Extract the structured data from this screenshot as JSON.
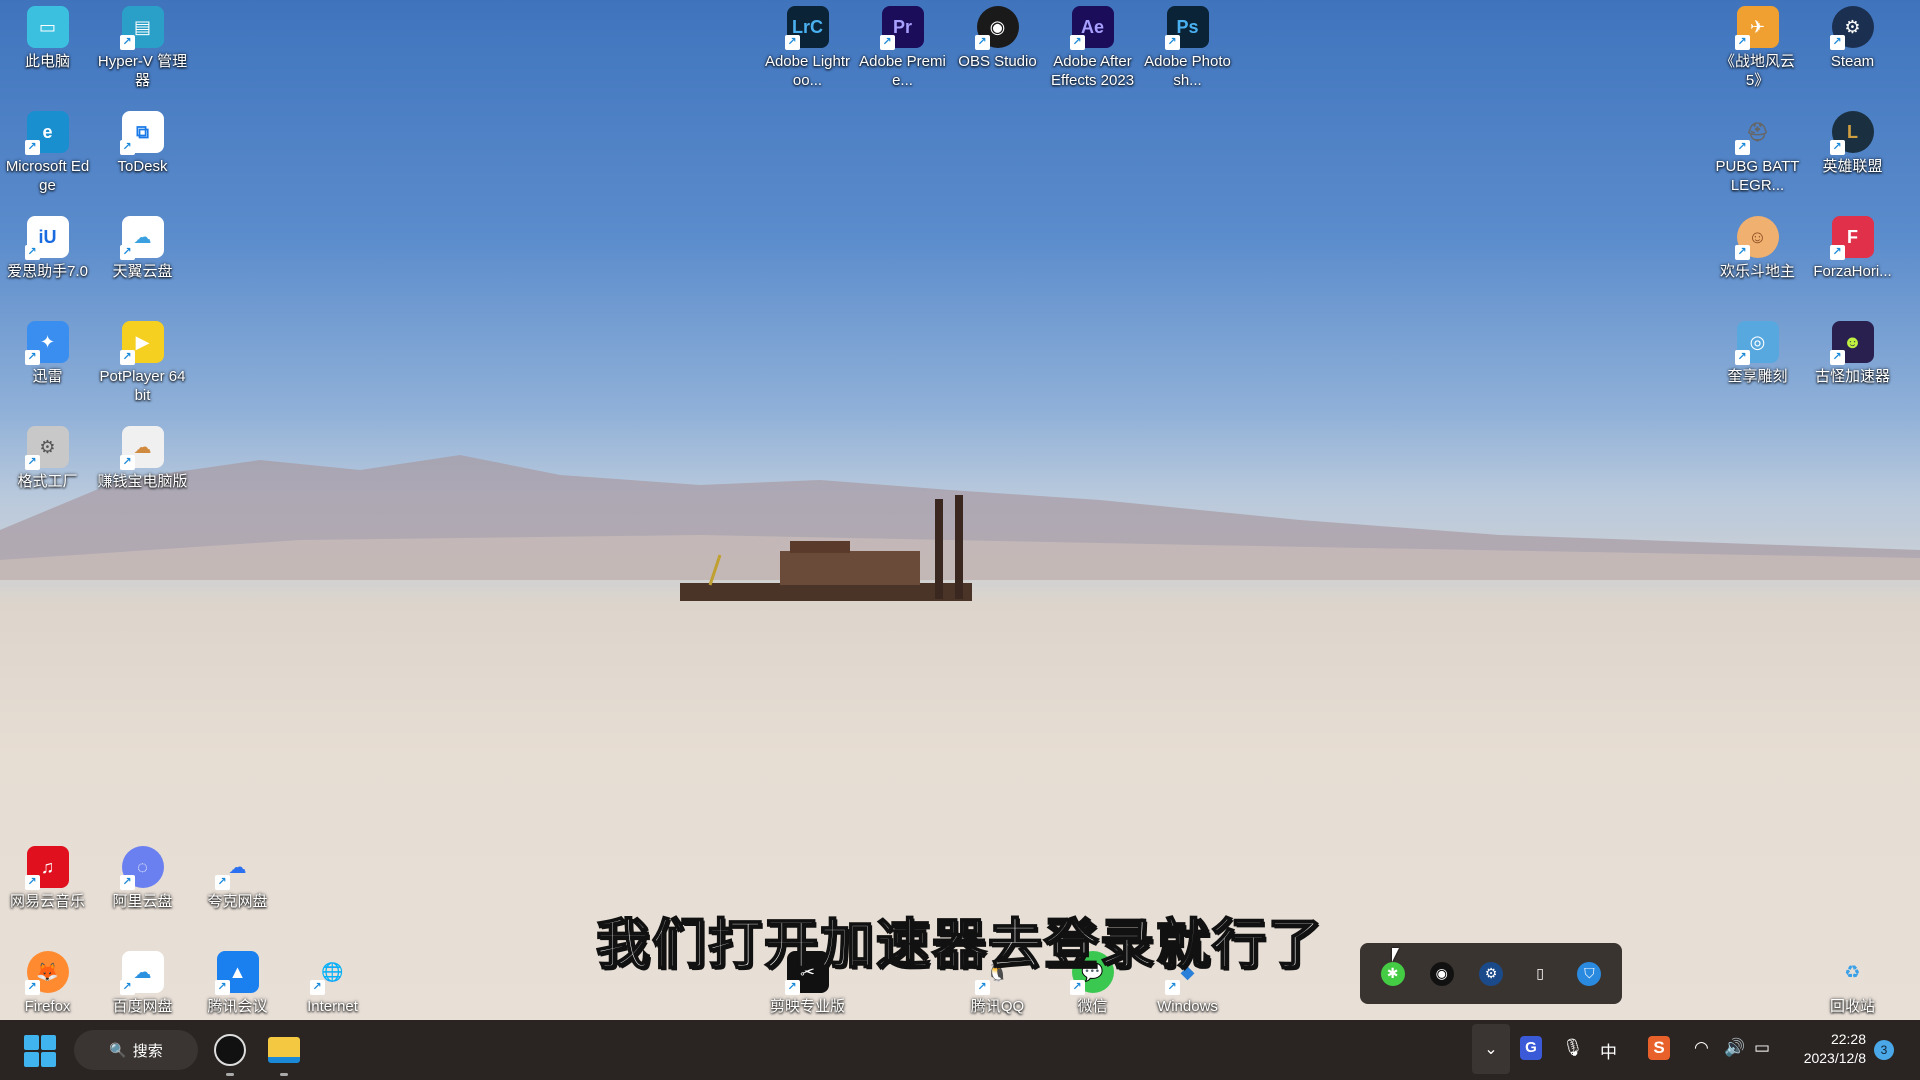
{
  "desktop": {
    "icons": [
      {
        "label": "此电脑",
        "glyph": "▭",
        "color": "#3cc0e0",
        "shortcut": false,
        "col": 0,
        "pos": "L",
        "row": 0
      },
      {
        "label": "Hyper-V 管理器",
        "glyph": "▤",
        "color": "#2aa0c8",
        "shortcut": true,
        "pos": "L",
        "col": 1,
        "row": 0
      },
      {
        "label": "Microsoft Edge",
        "glyph": "e",
        "color": "#1a8fd0",
        "shortcut": true,
        "pos": "L",
        "col": 0,
        "row": 1
      },
      {
        "label": "ToDesk",
        "glyph": "⧉",
        "color": "#ffffff",
        "fg": "#1a7ae8",
        "shortcut": true,
        "pos": "L",
        "col": 1,
        "row": 1
      },
      {
        "label": "爱思助手7.0",
        "glyph": "iU",
        "color": "#ffffff",
        "fg": "#1a6ae0",
        "shortcut": true,
        "pos": "L",
        "col": 0,
        "row": 2
      },
      {
        "label": "天翼云盘",
        "glyph": "☁",
        "color": "#ffffff",
        "fg": "#3aa0e0",
        "shortcut": true,
        "pos": "L",
        "col": 1,
        "row": 2
      },
      {
        "label": "迅雷",
        "glyph": "✦",
        "color": "#3a8ef0",
        "shortcut": true,
        "pos": "L",
        "col": 0,
        "row": 3
      },
      {
        "label": "PotPlayer 64 bit",
        "glyph": "▶",
        "color": "#f5d020",
        "shortcut": true,
        "pos": "L",
        "col": 1,
        "row": 3
      },
      {
        "label": "格式工厂",
        "glyph": "⚙",
        "color": "#c8c8c8",
        "fg": "#555",
        "shortcut": true,
        "pos": "L",
        "col": 0,
        "row": 4
      },
      {
        "label": "赚钱宝电脑版",
        "glyph": "☁",
        "color": "#f0f0f0",
        "fg": "#d08a40",
        "shortcut": true,
        "pos": "L",
        "col": 1,
        "row": 4
      },
      {
        "label": "Adobe Lightroo...",
        "glyph": "LrC",
        "color": "#0a2336",
        "fg": "#4ab0f0",
        "shortcut": true,
        "pos": "T",
        "col": 0
      },
      {
        "label": "Adobe Premie...",
        "glyph": "Pr",
        "color": "#1c0d5a",
        "fg": "#a8a0ff",
        "shortcut": true,
        "pos": "T",
        "col": 1
      },
      {
        "label": "OBS Studio",
        "glyph": "◉",
        "color": "#1a1a1a",
        "shortcut": true,
        "pos": "T",
        "col": 2,
        "round": true
      },
      {
        "label": "Adobe After Effects 2023",
        "glyph": "Ae",
        "color": "#1c0d5a",
        "fg": "#a8a0ff",
        "shortcut": true,
        "pos": "T",
        "col": 3
      },
      {
        "label": "Adobe Photosh...",
        "glyph": "Ps",
        "color": "#0a2336",
        "fg": "#4ab0f0",
        "shortcut": true,
        "pos": "T",
        "col": 4
      },
      {
        "label": "《战地风云 5》",
        "glyph": "✈",
        "color": "#f0a030",
        "shortcut": true,
        "pos": "R",
        "col": 0,
        "row": 0
      },
      {
        "label": "Steam",
        "glyph": "⚙",
        "color": "#1b2f50",
        "shortcut": true,
        "pos": "R",
        "col": 1,
        "row": 0,
        "round": true
      },
      {
        "label": "PUBG BATTLEGR...",
        "glyph": "⛑",
        "color": "transparent",
        "fg": "#666",
        "shortcut": true,
        "pos": "R",
        "col": 0,
        "row": 1
      },
      {
        "label": "英雄联盟",
        "glyph": "L",
        "color": "#1a3040",
        "fg": "#d0a040",
        "shortcut": true,
        "pos": "R",
        "col": 1,
        "row": 1,
        "round": true
      },
      {
        "label": "欢乐斗地主",
        "glyph": "☺",
        "color": "#f0b070",
        "fg": "#8a4a20",
        "shortcut": true,
        "pos": "R",
        "col": 0,
        "row": 2,
        "round": true
      },
      {
        "label": "ForzaHori...",
        "glyph": "F",
        "color": "#e0304a",
        "shortcut": true,
        "pos": "R",
        "col": 1,
        "row": 2
      },
      {
        "label": "奎享雕刻",
        "glyph": "◎",
        "color": "#58a8e0",
        "shortcut": true,
        "pos": "R",
        "col": 0,
        "row": 3
      },
      {
        "label": "古怪加速器",
        "glyph": "☻",
        "color": "#2a2050",
        "fg": "#c0f040",
        "shortcut": true,
        "pos": "R",
        "col": 1,
        "row": 3
      },
      {
        "label": "网易云音乐",
        "glyph": "♫",
        "color": "#e0101e",
        "shortcut": true,
        "pos": "B",
        "col": 0,
        "row": 0
      },
      {
        "label": "阿里云盘",
        "glyph": "◌",
        "color": "#6a80f0",
        "shortcut": true,
        "pos": "B",
        "col": 1,
        "row": 0,
        "round": true
      },
      {
        "label": "夸克网盘",
        "glyph": "☁",
        "color": "transparent",
        "fg": "#2a70f0",
        "shortcut": true,
        "pos": "B",
        "col": 2,
        "row": 0
      },
      {
        "label": "Firefox",
        "glyph": "🦊",
        "color": "#ff8a30",
        "shortcut": true,
        "pos": "B",
        "col": 0,
        "row": 1,
        "round": true
      },
      {
        "label": "百度网盘",
        "glyph": "☁",
        "color": "#ffffff",
        "fg": "#2a90e0",
        "shortcut": true,
        "pos": "B",
        "col": 1,
        "row": 1
      },
      {
        "label": "腾讯会议",
        "glyph": "▲",
        "color": "#1a80f0",
        "shortcut": true,
        "pos": "B",
        "col": 2,
        "row": 1
      },
      {
        "label": "Internet",
        "glyph": "🌐",
        "color": "transparent",
        "fg": "#2a9a3a",
        "shortcut": true,
        "pos": "B",
        "col": 3,
        "row": 1
      },
      {
        "label": "剪映专业版",
        "glyph": "✂",
        "color": "#111111",
        "shortcut": true,
        "pos": "BC",
        "col": 0
      },
      {
        "label": "腾讯QQ",
        "glyph": "🐧",
        "color": "transparent",
        "fg": "#111",
        "shortcut": true,
        "pos": "BC",
        "col": 2
      },
      {
        "label": "微信",
        "glyph": "💬",
        "color": "#3ac850",
        "shortcut": true,
        "pos": "BC",
        "col": 3,
        "round": true
      },
      {
        "label": "Windows",
        "glyph": "◆",
        "color": "transparent",
        "fg": "#2a80d8",
        "shortcut": true,
        "pos": "BC",
        "col": 4
      },
      {
        "label": "回收站",
        "glyph": "♻",
        "color": "transparent",
        "fg": "#3aa0e8",
        "shortcut": false,
        "pos": "RB",
        "col": 1,
        "row": 1
      }
    ]
  },
  "subtitle": "我们打开加速器去登录就行了",
  "tray_popup": {
    "items": [
      {
        "name": "razer-icon",
        "glyph": "✱",
        "color": "#44cc44"
      },
      {
        "name": "obs-icon",
        "glyph": "◉",
        "color": "#111111"
      },
      {
        "name": "steam-icon",
        "glyph": "⚙",
        "color": "#1b4a8a"
      },
      {
        "name": "usb-eject-icon",
        "glyph": "▯",
        "color": "transparent"
      },
      {
        "name": "defender-warning-icon",
        "glyph": "⛉",
        "color": "#2a8ae0"
      }
    ]
  },
  "taskbar": {
    "search_label": "搜索",
    "search_icon": "🔍",
    "chevron": "⌄",
    "ime_label": "中",
    "gbox_label": "G",
    "sogou_label": "S",
    "time": "22:28",
    "date": "2023/12/8",
    "notification_count": "3"
  }
}
